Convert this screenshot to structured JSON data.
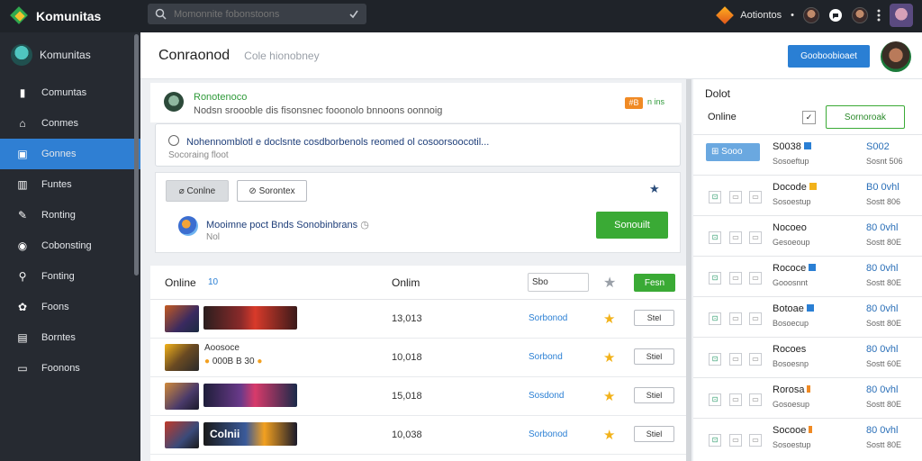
{
  "brand": {
    "name": "Komunitas"
  },
  "search": {
    "placeholder": "Momonnite fobonstoons"
  },
  "topbar": {
    "user_label": "Aotiontos",
    "notify_label": "•"
  },
  "sidebar": {
    "profile": "Komunitas",
    "items": [
      {
        "label": "Comuntas",
        "icon": "bag-icon"
      },
      {
        "label": "Conmes",
        "icon": "home-icon"
      },
      {
        "label": "Gonnes",
        "icon": "gamepad-icon"
      },
      {
        "label": "Funtes",
        "icon": "building-icon"
      },
      {
        "label": "Ronting",
        "icon": "feather-icon"
      },
      {
        "label": "Cobonsting",
        "icon": "circle-icon"
      },
      {
        "label": "Fonting",
        "icon": "search-icon"
      },
      {
        "label": "Foons",
        "icon": "gear-icon"
      },
      {
        "label": "Borntes",
        "icon": "book-icon"
      },
      {
        "label": "Foonons",
        "icon": "folder-icon"
      }
    ],
    "active_index": 2
  },
  "header": {
    "title": "Conraonod",
    "subtitle": "Cole hionobney",
    "action_button": "Gooboobioaet"
  },
  "post": {
    "author": "Ronotenoco",
    "text": "Nodsn sroooble dis fisonsnec fooonolo bnnoons oonnoig",
    "badge": "#B",
    "tag": "n ins"
  },
  "notice": {
    "text": "Nohennomblotl e doclsnte cosdborbenols reomed ol cosoorsoocotil...",
    "sub": "Socoraing floot"
  },
  "composer": {
    "btn_primary": "Conlne",
    "btn_secondary": "Sorontex",
    "entry_text": "Mooimne poct Bnds Sonobinbrans",
    "entry_sub": "Nol",
    "submit": "Sonouilt"
  },
  "table": {
    "header_label": "Online",
    "header_count": "10",
    "col_label": "Onlim",
    "filter_value": "Sbo",
    "action_label": "Fesn",
    "rows": [
      {
        "name": "",
        "extra": "",
        "time": "13,013",
        "status": "Sorbonod",
        "button": "Stel"
      },
      {
        "name": "Aoosoce",
        "extra": "000B B 30",
        "time": "10,018",
        "status": "Sorbond",
        "button": "Stiel"
      },
      {
        "name": "",
        "extra": "",
        "time": "15,018",
        "status": "Sosdond",
        "button": "Stiel"
      },
      {
        "name": "Colnii",
        "extra": "",
        "time": "10,038",
        "status": "Sorbonod",
        "button": "Stiel"
      }
    ]
  },
  "right_panel": {
    "title": "Dolot",
    "filter_label": "Online",
    "check_mark": "✓",
    "button": "Sornoroak",
    "rows": [
      {
        "tag": "Sooo",
        "name": "S0038",
        "sub": "Sosoeftup",
        "val": "S002",
        "val2": "Sosnt 506",
        "flag": "#2a7fd4"
      },
      {
        "name": "Docode",
        "sub": "Sosoestup",
        "val": "B0 0vhl",
        "val2": "Sostt 806",
        "flag": "#f2b21a"
      },
      {
        "name": "Nocoeo",
        "sub": "Gesoeoup",
        "val": "80 0vhl",
        "val2": "Sostt 80E",
        "flag": ""
      },
      {
        "name": "Rococe",
        "sub": "Gooosnnt",
        "val": "80 0vhl",
        "val2": "Sostt 80E",
        "flag": "#2a7fd4"
      },
      {
        "name": "Botoae",
        "sub": "Bosoecup",
        "val": "80 0vhl",
        "val2": "Sostt 80E",
        "flag": "#2a7fd4"
      },
      {
        "name": "Rocoes",
        "sub": "Bosoesnp",
        "val": "80 0vhl",
        "val2": "Sostt 60E",
        "flag": ""
      },
      {
        "name": "Rorosa",
        "sub": "Gosoesup",
        "val": "80 0vhl",
        "val2": "Sostt 80E",
        "flag": "#f08a24"
      },
      {
        "name": "Socooe",
        "sub": "Sosoestup",
        "val": "80 0vhl",
        "val2": "Sostt 80E",
        "flag": "#f08a24"
      }
    ]
  }
}
